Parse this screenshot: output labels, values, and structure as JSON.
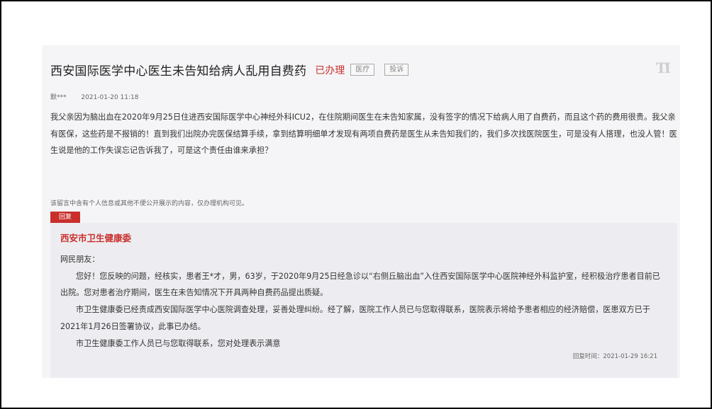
{
  "post": {
    "title": "西安国际医学中心医生未告知给病人乱用自费药",
    "status": "已办理",
    "tags": [
      "医疗",
      "投诉"
    ],
    "font_toggle": "TI",
    "author": "默***",
    "date": "2021-01-20 11:18",
    "content": "我父亲因为脑出血在2020年9月25日住进西安国际医学中心神经外科ICU2，在住院期间医生在未告知家属，没有签字的情况下给病人用了自费药，而且这个药的费用很贵。我父亲有医保，这些药是不报销的！直到我们出院办完医保结算手续，拿到结算明细单才发现有两项自费药是医生从未告知我们的，我们多次找医院医生，可是没有人搭理，也没人管！医生说是他的工作失误忘记告诉我了，可是这个责任由谁来承担？",
    "notice": "该留言中含有个人信息或其他不便公开展示的内容，仅办理机构可见。"
  },
  "reply": {
    "badge": "回复",
    "org": "西安市卫生健康委",
    "greeting": "网民朋友：",
    "paragraphs": [
      "您好！您反映的问题，经核实，患者王*才，男，63岁，于2020年9月25日经急诊以“右侧丘脑出血”入住西安国际医学中心医院神经外科监护室，经积极治疗患者目前已出院。您对患者治疗期间，医生在未告知情况下开具两种自费药品提出质疑。",
      "市卫生健康委已经责成西安国际医学中心医院调查处理，妥善处理纠纷。经了解，医院工作人员已与您取得联系，医院表示将给予患者相应的经济赔偿，医患双方已于2021年1月26日签署协议，此事已办结。",
      "市卫生健康委工作人员已与您取得联系，您对处理表示满意"
    ],
    "time": "回复时间：2021-01-29 16:21"
  }
}
